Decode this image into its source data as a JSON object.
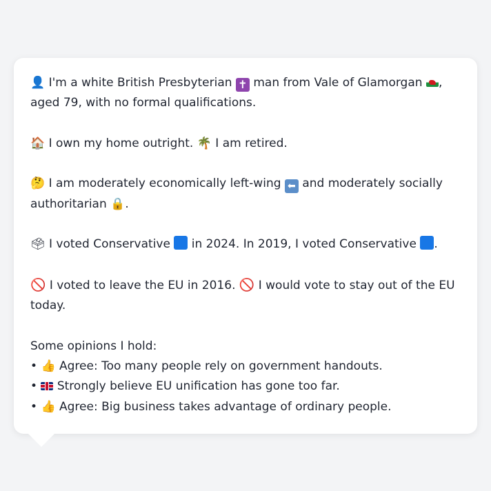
{
  "profile": {
    "p1_icon": "👤",
    "p1_a": " I'm a white British Presbyterian ",
    "p1_cross": "✝",
    "p1_b": " man from Vale of Glamorgan ",
    "p1_c": ", aged 79, with no formal qualifications.",
    "p2_icon": "🏠",
    "p2_a": " I own my home outright. ",
    "p2_palm": "🌴",
    "p2_b": " I am retired.",
    "p3_icon": "🤔",
    "p3_a": " I am moderately economically left-wing ",
    "p3_arrow": "⬅",
    "p3_b": " and moderately socially authoritarian ",
    "p3_lock": "🔒",
    "p3_c": ".",
    "p4_icon": "🗳",
    "p4_a": " I voted Conservative ",
    "p4_b": " in 2024. In 2019, I voted Conservative ",
    "p4_c": ".",
    "p5_icon": "🚫",
    "p5_a": " I voted to leave the EU in 2016. ",
    "p5_icon2": "🚫",
    "p5_b": " I would vote to stay out of the EU today.",
    "opinions_heading": "Some opinions I hold:",
    "opinions": [
      {
        "bullet": "•",
        "icon": "👍",
        "text": " Agree: Too many people rely on government handouts."
      },
      {
        "bullet": "•",
        "icon": "",
        "text": " Strongly believe EU unification has gone too far."
      },
      {
        "bullet": "•",
        "icon": "👍",
        "text": " Agree: Big business takes advantage of ordinary people."
      }
    ]
  },
  "icons": {
    "wales_flag": "wales-flag-icon",
    "uk_flag": "uk-flag-icon",
    "conservative_square": "blue-square-icon"
  },
  "colors": {
    "background": "#f3f4f6",
    "card": "#ffffff",
    "text": "#1f2430",
    "conservative_blue": "#1877e6"
  }
}
